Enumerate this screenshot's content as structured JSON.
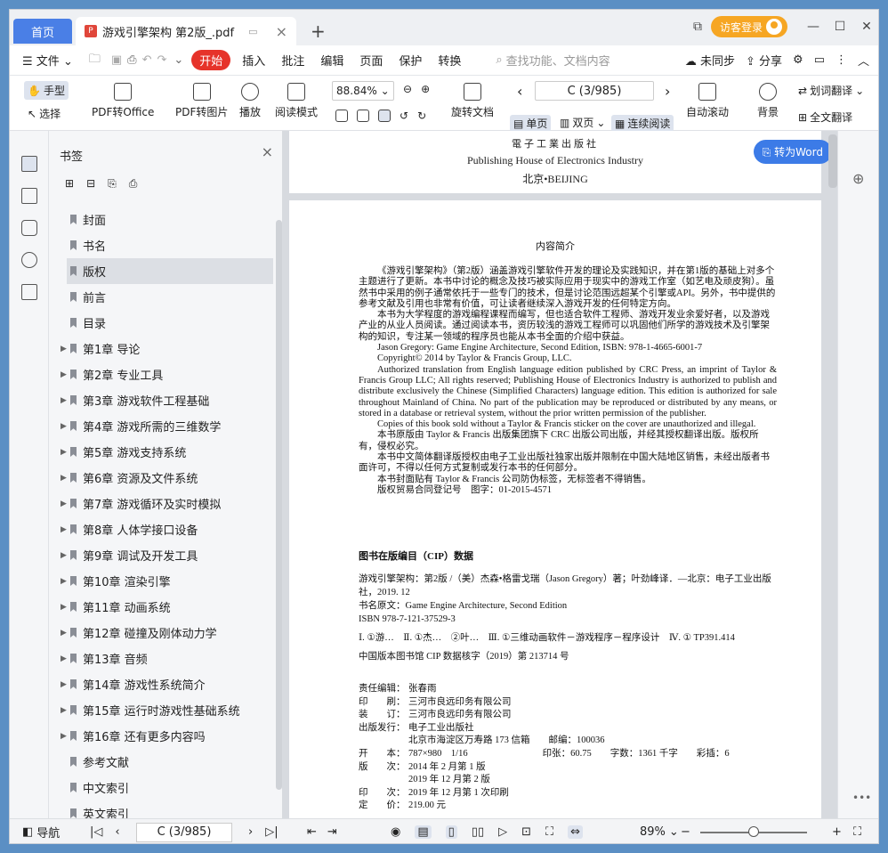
{
  "tabs": {
    "home": "首页",
    "doc": "游戏引擎架构 第2版_.pdf"
  },
  "titlebar": {
    "login": "访客登录"
  },
  "menu": {
    "file": "文件",
    "start": "开始",
    "items": [
      "插入",
      "批注",
      "编辑",
      "页面",
      "保护",
      "转换"
    ],
    "search_placeholder": "查找功能、文档内容",
    "unsync": "未同步",
    "share": "分享"
  },
  "ribbon": {
    "hand": "手型",
    "select": "选择",
    "pdf_office": "PDF转Office",
    "pdf_image": "PDF转图片",
    "play": "播放",
    "read_mode": "阅读模式",
    "zoom": "88.84%",
    "page": "C (3/985)",
    "rotate_doc": "旋转文档",
    "single": "单页",
    "double": "双页",
    "continuous": "连续阅读",
    "auto_scroll": "自动滚动",
    "background": "背景",
    "word_translate": "划词翻译",
    "full_translate": "全文翻译"
  },
  "bookmarks": {
    "title": "书签",
    "items": [
      {
        "label": "封面",
        "expand": false
      },
      {
        "label": "书名",
        "expand": false
      },
      {
        "label": "版权",
        "expand": false,
        "active": true
      },
      {
        "label": "前言",
        "expand": false
      },
      {
        "label": "目录",
        "expand": false
      },
      {
        "label": "第1章 导论",
        "expand": true
      },
      {
        "label": "第2章 专业工具",
        "expand": true
      },
      {
        "label": "第3章 游戏软件工程基础",
        "expand": true
      },
      {
        "label": "第4章 游戏所需的三维数学",
        "expand": true
      },
      {
        "label": "第5章 游戏支持系统",
        "expand": true
      },
      {
        "label": "第6章 资源及文件系统",
        "expand": true
      },
      {
        "label": "第7章 游戏循环及实时模拟",
        "expand": true
      },
      {
        "label": "第8章 人体学接口设备",
        "expand": true
      },
      {
        "label": "第9章 调试及开发工具",
        "expand": true
      },
      {
        "label": "第10章 渲染引擎",
        "expand": true
      },
      {
        "label": "第11章 动画系统",
        "expand": true
      },
      {
        "label": "第12章 碰撞及刚体动力学",
        "expand": true
      },
      {
        "label": "第13章 音频",
        "expand": true
      },
      {
        "label": "第14章 游戏性系统简介",
        "expand": true
      },
      {
        "label": "第15章 运行时游戏性基础系统",
        "expand": true
      },
      {
        "label": "第16章 还有更多内容吗",
        "expand": true
      },
      {
        "label": "参考文献",
        "expand": false
      },
      {
        "label": "中文索引",
        "expand": false
      },
      {
        "label": "英文索引",
        "expand": false
      }
    ]
  },
  "doc": {
    "publisher_cn": "電子工業出版社",
    "publisher_en": "Publishing House of Electronics Industry",
    "city": "北京•BEIJING",
    "to_word": "转为Word",
    "heading": "内容简介",
    "paras": [
      "《游戏引擎架构》（第2版）涵盖游戏引擎软件开发的理论及实践知识，并在第1版的基础上对多个主题进行了更新。本书中讨论的概念及技巧被实际应用于现实中的游戏工作室（如艺电及顽皮狗）。虽然书中采用的例子通常依托于一些专门的技术，但是讨论范围远超某个引擎或API。另外，书中提供的参考文献及引用也非常有价值，可让读者继续深入游戏开发的任何特定方向。",
      "本书为大学程度的游戏编程课程而编写，但也适合软件工程师、游戏开发业余爱好者，以及游戏产业的从业人员阅读。通过阅读本书，资历较浅的游戏工程师可以巩固他们所学的游戏技术及引擎架构的知识，专注某一领域的程序员也能从本书全面的介绍中获益。",
      "Jason Gregory: Game Engine Architecture, Second Edition, ISBN: 978-1-4665-6001-7",
      "Copyright© 2014 by Taylor & Francis Group, LLC.",
      "Authorized translation from English language edition published by CRC Press, an imprint of Taylor & Francis Group LLC; All rights reserved; Publishing House of Electronics Industry is authorized to publish and distribute exclusively the Chinese (Simplified Characters) language edition. This edition is authorized for sale throughout Mainland of China. No part of the publication may be reproduced or distributed by any means, or stored in a database or retrieval system, without the prior written permission of the publisher.",
      "Copies of this book sold without a Taylor & Francis sticker on the cover are unauthorized and illegal.",
      "本书原版由 Taylor & Francis 出版集团旗下 CRC 出版公司出版，并经其授权翻译出版。版权所有，侵权必究。",
      "本书中文简体翻译版授权由电子工业出版社独家出版并限制在中国大陆地区销售，未经出版者书面许可，不得以任何方式复制或发行本书的任何部分。",
      "本书封面贴有 Taylor & Francis 公司防伪标签，无标签者不得销售。",
      "版权贸易合同登记号　图字：01-2015-4571"
    ],
    "cip_title": "图书在版编目（CIP）数据",
    "cip_lines": [
      "游戏引擎架构：第2版 /（美）杰森•格雷戈瑞（Jason Gregory）著；叶劲峰译．—北京：电子工业出版社，2019. 12",
      "书名原文：Game Engine Architecture, Second Edition",
      "ISBN 978-7-121-37529-3",
      "Ⅰ. ①游…　Ⅱ. ①杰…　②叶…　Ⅲ. ①三维动画软件－游戏程序－程序设计　Ⅳ. ① TP391.414",
      "中国版本图书馆 CIP 数据核字（2019）第 213714 号"
    ],
    "credits": [
      [
        "责任编辑：",
        "张春雨"
      ],
      [
        "印　　刷：",
        "三河市良远印务有限公司"
      ],
      [
        "装　　订：",
        "三河市良远印务有限公司"
      ],
      [
        "出版发行：",
        "电子工业出版社"
      ],
      [
        "",
        "北京市海淀区万寿路 173 信箱　　邮编：100036"
      ],
      [
        "开　　本：",
        "787×980　1/16　　　　　　　　印张：60.75　　字数：1361 千字　　彩插：6"
      ],
      [
        "版　　次：",
        "2014 年 2 月第 1 版"
      ],
      [
        "",
        "2019 年 12 月第 2 版"
      ],
      [
        "印　　次：",
        "2019 年 12 月第 1 次印刷"
      ],
      [
        "定　　价：",
        "219.00 元"
      ]
    ]
  },
  "status": {
    "nav": "导航",
    "page": "C (3/985)",
    "zoom": "89%"
  }
}
